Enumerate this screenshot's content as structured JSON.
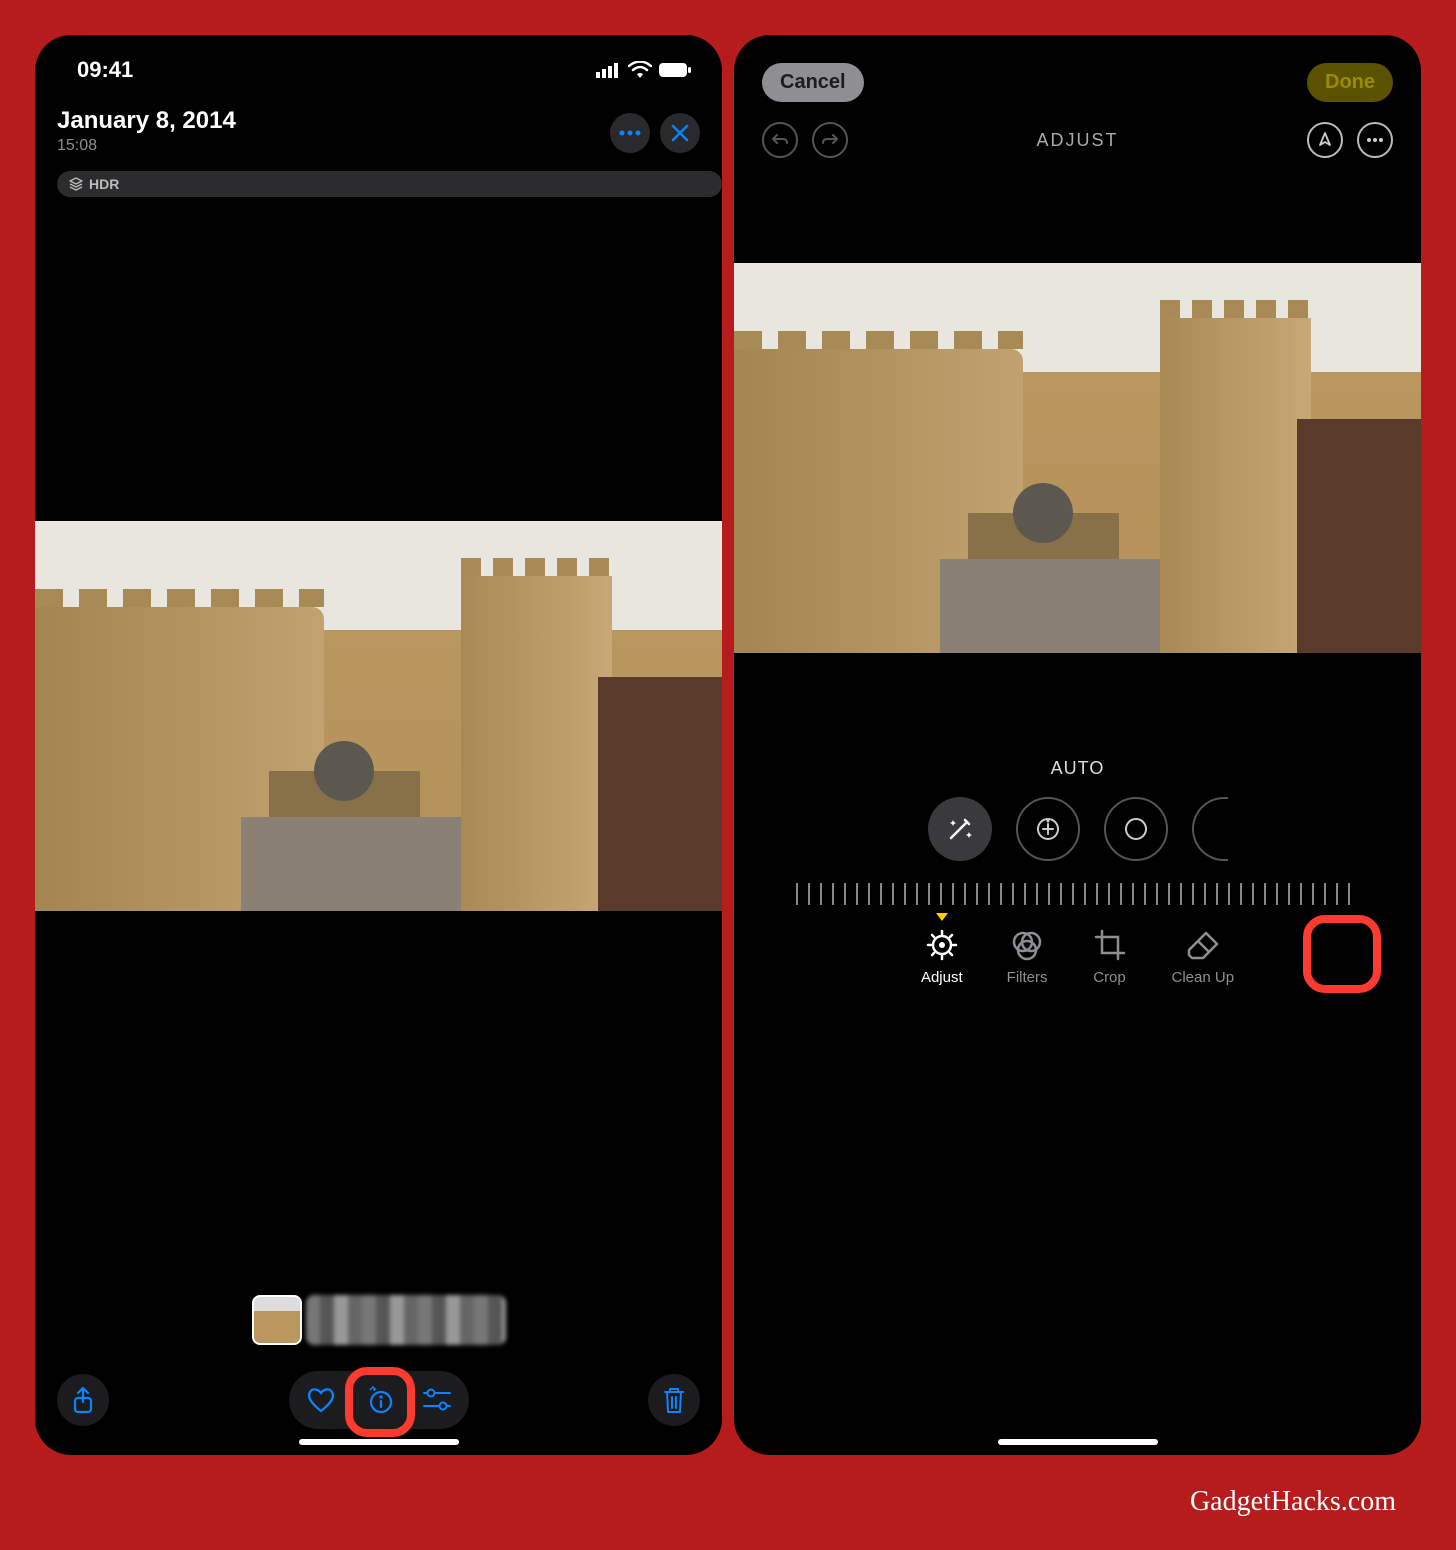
{
  "status_bar": {
    "time": "09:41"
  },
  "left": {
    "date_title": "January 8, 2014",
    "time": "15:08",
    "hdr_label": "HDR",
    "toolbar": {
      "share": "Share",
      "favorite": "Favorite",
      "live": "Live",
      "edit": "Edit",
      "trash": "Trash",
      "more": "More",
      "close": "Close"
    }
  },
  "right": {
    "cancel": "Cancel",
    "done": "Done",
    "section_title": "ADJUST",
    "auto_label": "AUTO",
    "dials": [
      "Auto",
      "Exposure",
      "Brilliance"
    ],
    "tabs": {
      "adjust": "Adjust",
      "filters": "Filters",
      "crop": "Crop",
      "cleanup": "Clean Up"
    }
  },
  "attribution": "GadgetHacks.com"
}
